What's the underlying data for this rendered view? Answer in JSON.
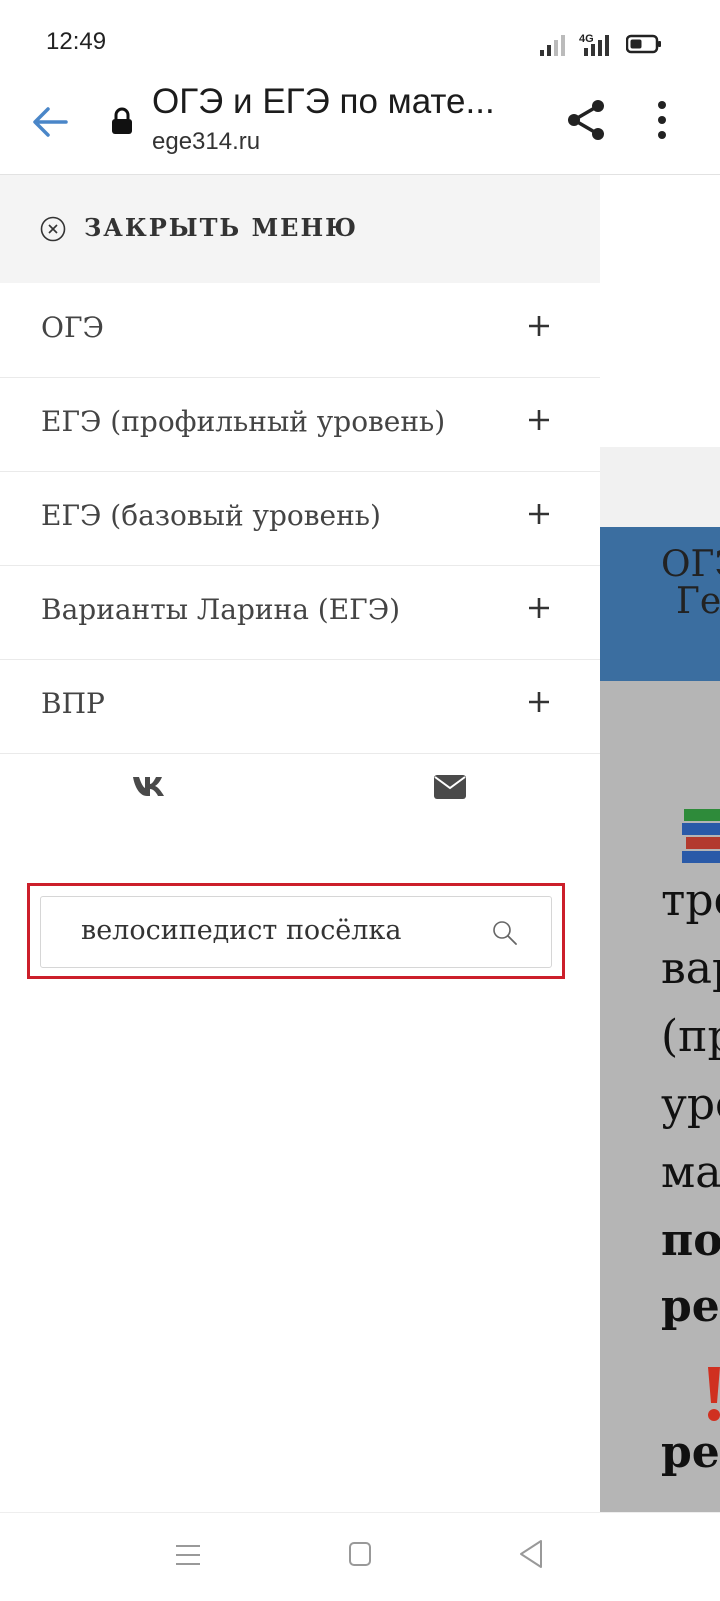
{
  "status_bar": {
    "time": "12:49",
    "network": "4G"
  },
  "browser": {
    "title": "ОГЭ и ЕГЭ по мате...",
    "domain": "ege314.ru"
  },
  "drawer": {
    "close_label": "ЗАКРЫТЬ МЕНЮ",
    "items": [
      {
        "label": "ОГЭ"
      },
      {
        "label": "ЕГЭ (профильный уровень)"
      },
      {
        "label": "ЕГЭ (базовый уровень)"
      },
      {
        "label": "Варианты Ларина (ЕГЭ)"
      },
      {
        "label": "ВПР"
      }
    ],
    "search": {
      "value": "велосипедист посёлка"
    }
  },
  "background_page": {
    "heading_line1": "ОГЭ",
    "heading_line2": "Ге",
    "body_lines": [
      "тре",
      "вар",
      "(пр",
      "уро",
      "ма",
      "по",
      "ре",
      "ре"
    ]
  },
  "colors": {
    "accent_blue": "#4a86c8",
    "highlight_red": "#cc1f2a",
    "header_blue": "#3b6ea0"
  }
}
